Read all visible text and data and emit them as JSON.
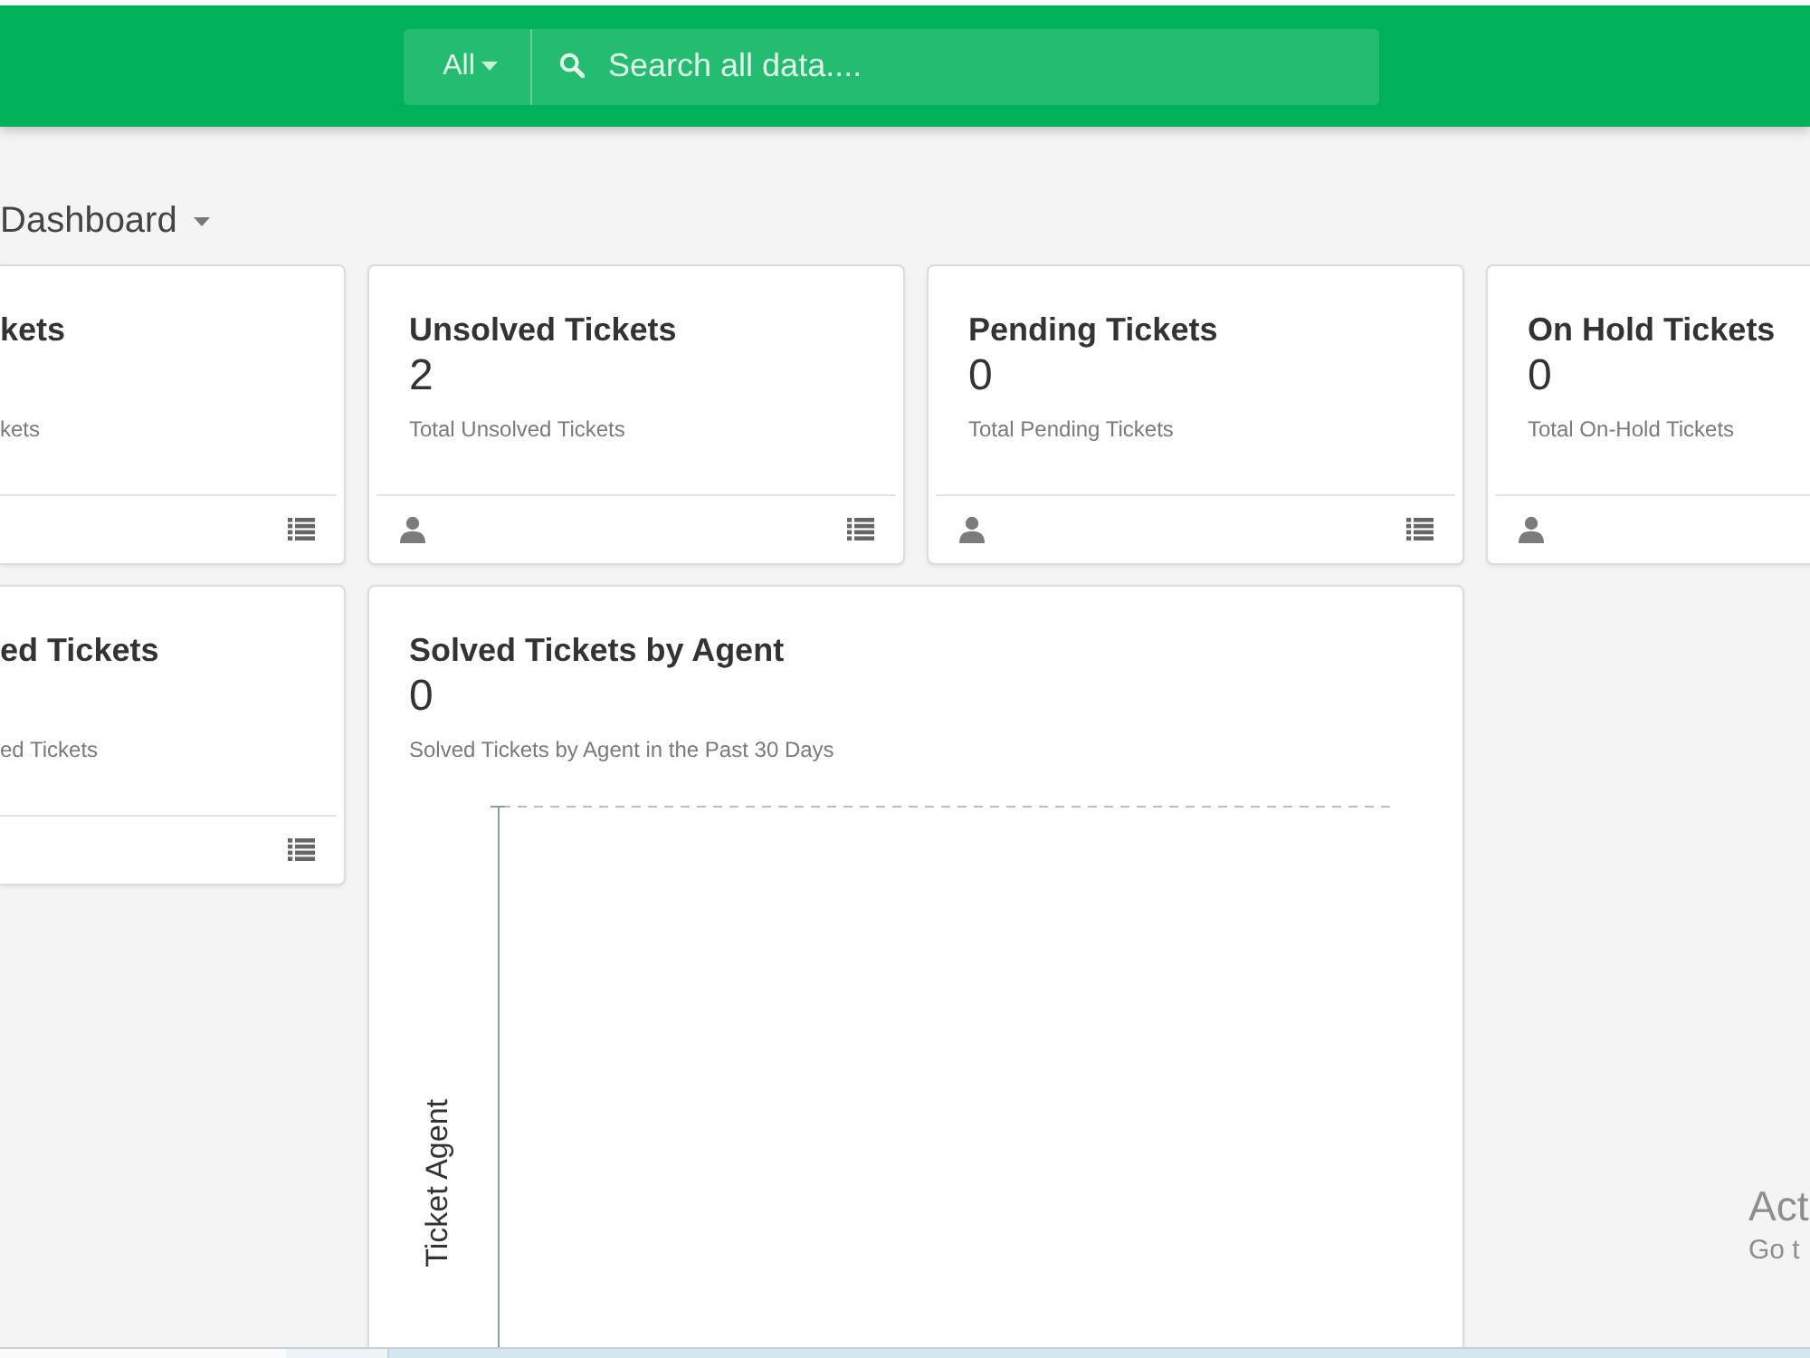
{
  "header": {
    "scope": {
      "label": "All"
    },
    "search": {
      "placeholder": "Search all data...."
    }
  },
  "page": {
    "title": "Dashboard"
  },
  "cards": [
    {
      "kind": "clipped_left",
      "title": "kets",
      "subtitle": "kets"
    },
    {
      "kind": "stat",
      "title": "Unsolved Tickets",
      "value": "2",
      "subtitle": "Total Unsolved Tickets"
    },
    {
      "kind": "stat",
      "title": "Pending Tickets",
      "value": "0",
      "subtitle": "Total Pending Tickets"
    },
    {
      "kind": "clipped_right",
      "title": "On Hold Tickets",
      "value": "0",
      "subtitle": "Total On-Hold Tickets"
    },
    {
      "kind": "clipped_left",
      "title": "ed Tickets",
      "subtitle": "ed Tickets"
    },
    {
      "kind": "chart",
      "title": "Solved Tickets by Agent",
      "value": "0",
      "subtitle": "Solved Tickets by Agent in the Past 30 Days",
      "y_axis_label": "Ticket Agent"
    }
  ],
  "os_notice": {
    "title": "Act",
    "subtitle": "Go t"
  }
}
